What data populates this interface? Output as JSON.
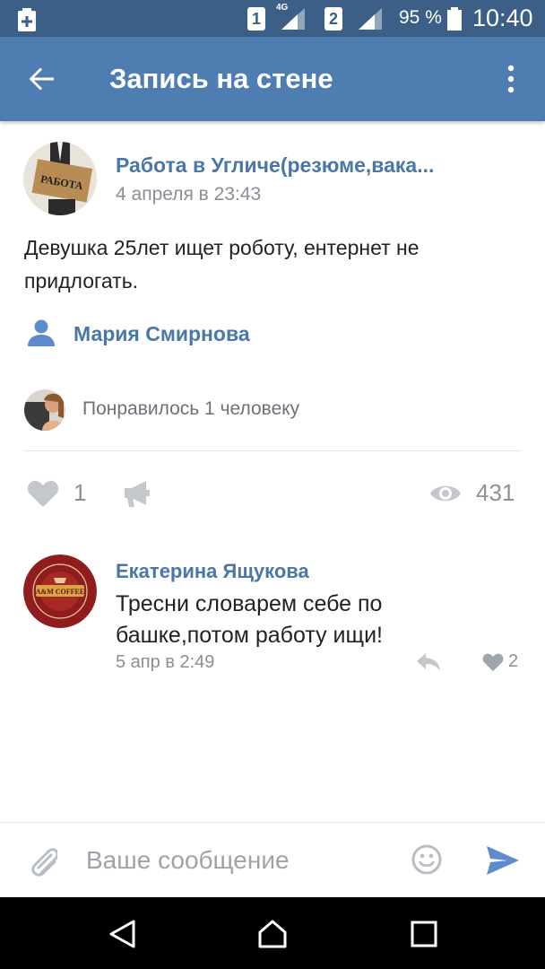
{
  "status_bar": {
    "sim1": "1",
    "sim2": "2",
    "network": "4G",
    "battery": "95 %",
    "time": "10:40"
  },
  "header": {
    "title": "Запись на стене"
  },
  "post": {
    "author": "Работа в Угличе(резюме,вака...",
    "date": "4 апреля в 23:43",
    "avatar_text": "РАБОТА",
    "text": "Девушка 25лет ищет роботу, ентернет не придлогать.",
    "signer": "Мария Смирнова",
    "liked_by": "Понравилось 1 человеку",
    "likes": "1",
    "views": "431"
  },
  "comment": {
    "author": "Екатерина Ящукова",
    "avatar_text": "A&M COFFEE",
    "text": "Тресни словарем себе по башке,потом работу ищи!",
    "date": "5 апр в 2:49",
    "likes": "2"
  },
  "composer": {
    "placeholder": "Ваше сообщение"
  },
  "colors": {
    "status_bar": "#3b5f86",
    "app_bar": "#4e7db1",
    "link": "#4a76a8",
    "icon_gray": "#c4c8cc"
  },
  "icons": [
    "plus-icon",
    "signal-icon",
    "battery-icon",
    "back-arrow-icon",
    "more-vert-icon",
    "person-icon",
    "heart-icon",
    "share-megaphone-icon",
    "eye-icon",
    "reply-icon",
    "attach-icon",
    "smile-icon",
    "send-icon",
    "nav-back-icon",
    "nav-home-icon",
    "nav-recents-icon"
  ]
}
